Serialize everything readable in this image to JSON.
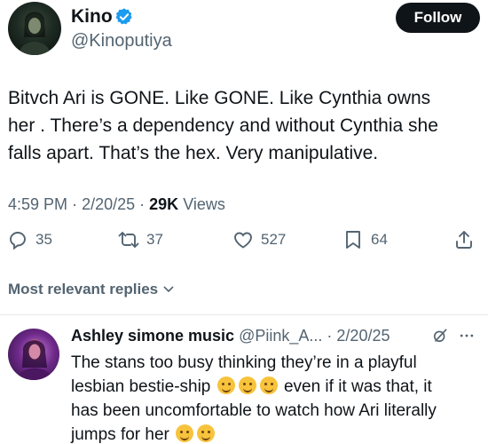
{
  "tweet": {
    "author_name": "Kino",
    "author_handle": "@Kinoputiya",
    "follow_label": "Follow",
    "text_line1": "Bitvch Ari is GONE. Like GONE. Like Cynthia owns",
    "text_line2": "her . There’s a dependency and without Cynthia she",
    "text_line3": "falls apart. That’s the hex. Very manipulative.",
    "time": "4:59 PM",
    "date": "2/20/25",
    "views_count": "29K",
    "views_label": "Views",
    "replies": "35",
    "retweets": "37",
    "likes": "527",
    "bookmarks": "64"
  },
  "sort_label": "Most relevant replies",
  "reply": {
    "name": "Ashley simone music",
    "handle": "@Piink_A...",
    "date": "2/20/25",
    "line1": "The stans too busy thinking they’re in a playful",
    "line2a": "lesbian bestie-ship",
    "line2b": "even if it was that, it",
    "line3": "has been uncomfortable to watch how Ari literally",
    "line4": "jumps for her"
  },
  "colors": {
    "text": "#0f1419",
    "secondary": "#536471",
    "verified": "#1d9bf0",
    "follow_bg": "#0f1419"
  },
  "icons": [
    "verified-badge-icon",
    "reply-icon",
    "retweet-icon",
    "like-icon",
    "bookmark-icon",
    "share-icon",
    "chevron-down-icon",
    "grok-icon",
    "more-icon",
    "emoji-icon"
  ]
}
